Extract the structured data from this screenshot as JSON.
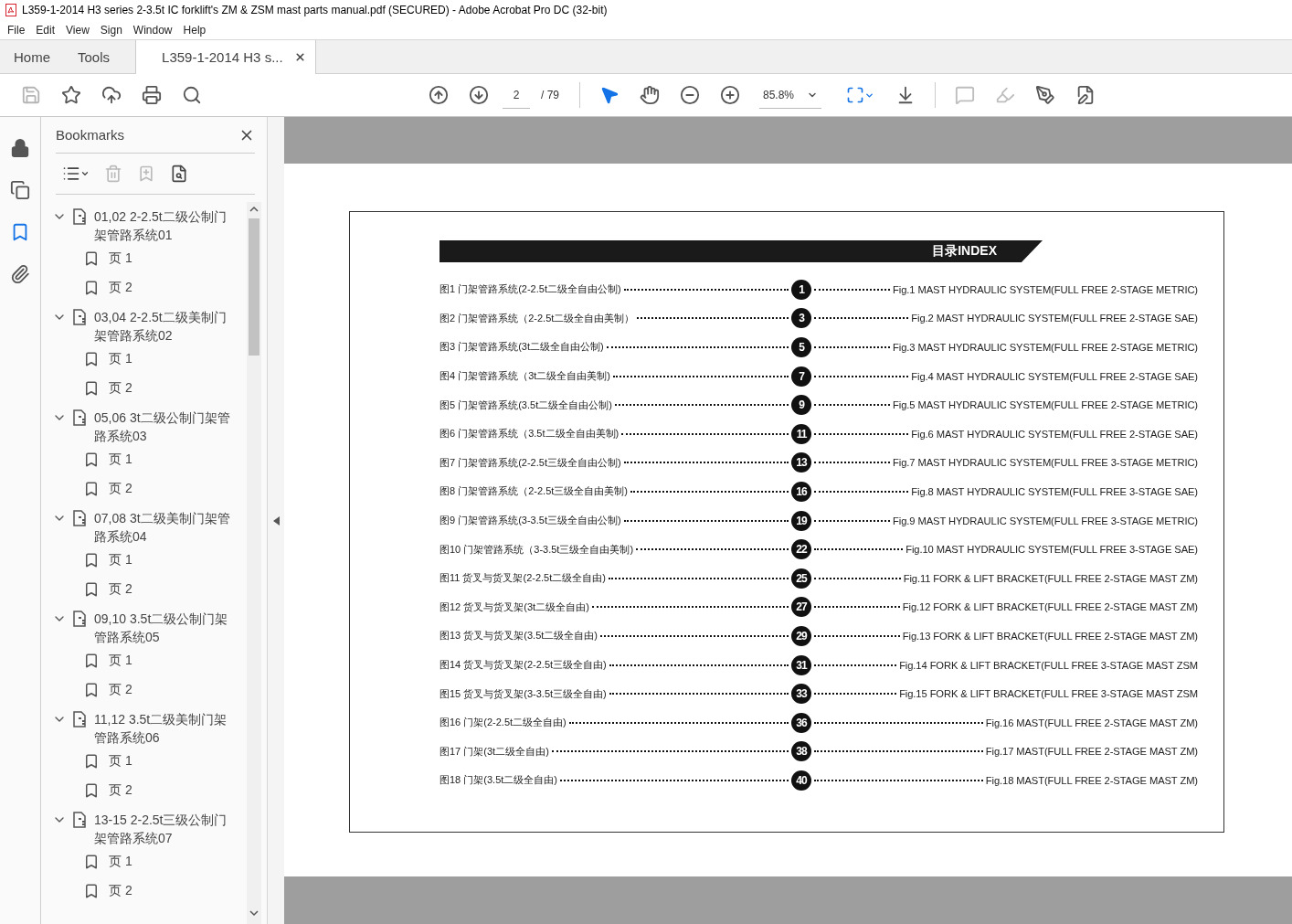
{
  "window": {
    "title": "L359-1-2014 H3 series 2-3.5t IC forklift's ZM & ZSM mast parts manual.pdf (SECURED) - Adobe Acrobat Pro DC (32-bit)"
  },
  "menu": [
    "File",
    "Edit",
    "View",
    "Sign",
    "Window",
    "Help"
  ],
  "tabs": [
    {
      "label": "Home",
      "kind": "nav",
      "selected": false
    },
    {
      "label": "Tools",
      "kind": "nav",
      "selected": false
    },
    {
      "label": "L359-1-2014 H3 s...",
      "kind": "document",
      "selected": true
    }
  ],
  "toolbar": {
    "file_tools": [
      {
        "kind": "save",
        "disabled": true
      },
      {
        "kind": "star",
        "disabled": false
      },
      {
        "kind": "upload",
        "disabled": false
      },
      {
        "kind": "print",
        "disabled": false
      },
      {
        "kind": "search",
        "disabled": false
      }
    ],
    "page": "2",
    "page_count": "/ 79",
    "zoom": "85.8%",
    "view_tools": [
      {
        "kind": "select",
        "selected": true
      },
      {
        "kind": "hand",
        "selected": false
      },
      {
        "kind": "zoom-out",
        "selected": false
      },
      {
        "kind": "zoom-in",
        "selected": false
      }
    ],
    "edit_tools": [
      {
        "kind": "comment",
        "disabled": true
      },
      {
        "kind": "highlight",
        "disabled": true
      },
      {
        "kind": "sign",
        "disabled": false
      },
      {
        "kind": "edit",
        "disabled": false
      }
    ]
  },
  "side_rail": [
    {
      "kind": "lock",
      "selected": false
    },
    {
      "kind": "pages",
      "selected": false
    },
    {
      "kind": "bookmarks",
      "selected": true
    },
    {
      "kind": "attachments",
      "selected": false
    }
  ],
  "bookmarks": {
    "title": "Bookmarks",
    "tools": [
      {
        "kind": "options",
        "disabled": false
      },
      {
        "kind": "delete",
        "disabled": true
      },
      {
        "kind": "add",
        "disabled": true
      },
      {
        "kind": "find",
        "disabled": false
      }
    ],
    "items": [
      {
        "label": "01,02 2-2.5t二级公制门架管路系统01",
        "expanded": true,
        "children": [
          {
            "label": "页 1"
          },
          {
            "label": "页 2"
          }
        ]
      },
      {
        "label": "03,04 2-2.5t二级美制门架管路系统02",
        "expanded": true,
        "children": [
          {
            "label": "页 1"
          },
          {
            "label": "页 2"
          }
        ]
      },
      {
        "label": "05,06 3t二级公制门架管路系统03",
        "expanded": true,
        "children": [
          {
            "label": "页 1"
          },
          {
            "label": "页 2"
          }
        ]
      },
      {
        "label": "07,08 3t二级美制门架管路系统04",
        "expanded": true,
        "children": [
          {
            "label": "页 1"
          },
          {
            "label": "页 2"
          }
        ]
      },
      {
        "label": "09,10 3.5t二级公制门架管路系统05",
        "expanded": true,
        "children": [
          {
            "label": "页 1"
          },
          {
            "label": "页 2"
          }
        ]
      },
      {
        "label": "11,12 3.5t二级美制门架管路系统06",
        "expanded": true,
        "children": [
          {
            "label": "页 1"
          },
          {
            "label": "页 2"
          }
        ]
      },
      {
        "label": "13-15 2-2.5t三级公制门架管路系统07",
        "expanded": true,
        "children": [
          {
            "label": "页 1"
          },
          {
            "label": "页 2"
          }
        ]
      }
    ]
  },
  "document": {
    "heading": "目录INDEX",
    "entries": [
      {
        "cn": "图1 门架管路系统(2-2.5t二级全自由公制)",
        "page": "1",
        "en": "Fig.1 MAST HYDRAULIC SYSTEM(FULL FREE 2-STAGE METRIC)"
      },
      {
        "cn": "图2 门架管路系统（2-2.5t二级全自由美制）",
        "page": "3",
        "en": "Fig.2 MAST HYDRAULIC SYSTEM(FULL FREE 2-STAGE SAE)"
      },
      {
        "cn": "图3 门架管路系统(3t二级全自由公制)",
        "page": "5",
        "en": "Fig.3 MAST HYDRAULIC SYSTEM(FULL FREE 2-STAGE METRIC)"
      },
      {
        "cn": "图4 门架管路系统（3t二级全自由美制)",
        "page": "7",
        "en": "Fig.4 MAST HYDRAULIC SYSTEM(FULL FREE 2-STAGE SAE)"
      },
      {
        "cn": "图5 门架管路系统(3.5t二级全自由公制)",
        "page": "9",
        "en": "Fig.5 MAST HYDRAULIC SYSTEM(FULL FREE 2-STAGE METRIC)"
      },
      {
        "cn": "图6 门架管路系统（3.5t二级全自由美制)",
        "page": "11",
        "en": "Fig.6 MAST HYDRAULIC SYSTEM(FULL FREE 2-STAGE SAE)"
      },
      {
        "cn": "图7 门架管路系统(2-2.5t三级全自由公制)",
        "page": "13",
        "en": "Fig.7 MAST HYDRAULIC SYSTEM(FULL FREE 3-STAGE METRIC)"
      },
      {
        "cn": "图8 门架管路系统（2-2.5t三级全自由美制)",
        "page": "16",
        "en": "Fig.8 MAST HYDRAULIC SYSTEM(FULL FREE 3-STAGE SAE)"
      },
      {
        "cn": "图9 门架管路系统(3-3.5t三级全自由公制)",
        "page": "19",
        "en": "Fig.9 MAST HYDRAULIC SYSTEM(FULL FREE 3-STAGE METRIC)"
      },
      {
        "cn": "图10 门架管路系统（3-3.5t三级全自由美制)",
        "page": "22",
        "en": "Fig.10 MAST HYDRAULIC SYSTEM(FULL FREE 3-STAGE SAE)"
      },
      {
        "cn": "图11 货叉与货叉架(2-2.5t二级全自由)",
        "page": "25",
        "en": "Fig.11 FORK & LIFT BRACKET(FULL FREE 2-STAGE MAST ZM)"
      },
      {
        "cn": "图12 货叉与货叉架(3t二级全自由)",
        "page": "27",
        "en": "Fig.12 FORK & LIFT BRACKET(FULL FREE 2-STAGE MAST ZM)"
      },
      {
        "cn": "图13 货叉与货叉架(3.5t二级全自由)",
        "page": "29",
        "en": "Fig.13 FORK & LIFT BRACKET(FULL FREE 2-STAGE MAST ZM)"
      },
      {
        "cn": "图14 货叉与货叉架(2-2.5t三级全自由)",
        "page": "31",
        "en": "Fig.14 FORK & LIFT BRACKET(FULL FREE 3-STAGE MAST ZSM"
      },
      {
        "cn": "图15 货叉与货叉架(3-3.5t三级全自由)",
        "page": "33",
        "en": "Fig.15 FORK & LIFT BRACKET(FULL FREE 3-STAGE MAST ZSM"
      },
      {
        "cn": "图16 门架(2-2.5t二级全自由)",
        "page": "36",
        "en": "Fig.16 MAST(FULL FREE 2-STAGE MAST ZM)"
      },
      {
        "cn": "图17 门架(3t二级全自由)",
        "page": "38",
        "en": "Fig.17 MAST(FULL FREE 2-STAGE MAST ZM)"
      },
      {
        "cn": "图18 门架(3.5t二级全自由)",
        "page": "40",
        "en": "Fig.18 MAST(FULL FREE 2-STAGE MAST ZM)"
      }
    ]
  }
}
